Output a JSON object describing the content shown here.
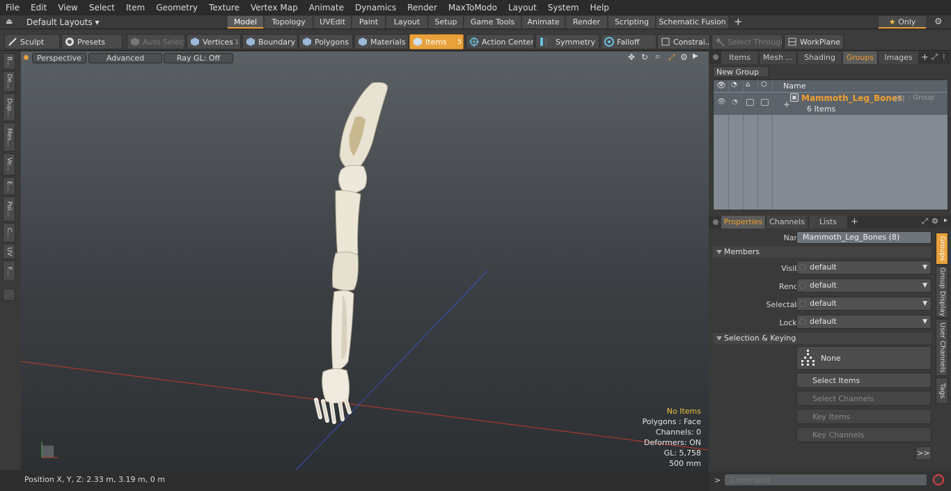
{
  "menu": [
    "File",
    "Edit",
    "View",
    "Select",
    "Item",
    "Geometry",
    "Texture",
    "Vertex Map",
    "Animate",
    "Dynamics",
    "Render",
    "MaxToModo",
    "Layout",
    "System",
    "Help"
  ],
  "layouts": {
    "label": "Default Layouts"
  },
  "mode_tabs": [
    "Model",
    "Topology",
    "UVEdit",
    "Paint",
    "Layout",
    "Setup",
    "Game Tools",
    "Animate",
    "Render",
    "Scripting",
    "Schematic Fusion"
  ],
  "only_label": "Only",
  "toolbar": {
    "sculpt": "Sculpt",
    "presets": "Presets",
    "auto_select": "Auto Select",
    "vertices": "Vertices",
    "vertices_count": "1",
    "boundary": "Boundary",
    "polygons": "Polygons",
    "materials": "Materials",
    "items": "Items",
    "items_count": "5",
    "action_center": "Action Center",
    "symmetry": "Symmetry",
    "falloff": "Falloff",
    "constraints": "Constrai...",
    "select_through": "Select Through",
    "workplane": "WorkPlane"
  },
  "left_tabs": [
    "B...",
    "De...",
    "Dup...",
    "Mes...",
    "Ve...",
    "E...",
    "Pol...",
    "C...",
    "UV",
    "F..."
  ],
  "viewport": {
    "perspective": "Perspective",
    "advanced": "Advanced",
    "raygl": "Ray GL: Off",
    "hud": {
      "no_items": "No Items",
      "polygons": "Polygons : Face",
      "channels": "Channels: 0",
      "deformers": "Deformers: ON",
      "gl": "GL: 5,758",
      "scale": "500 mm"
    }
  },
  "status": {
    "position": "Position X, Y, Z:   2.33 m, 3.19 m, 0 m"
  },
  "right_tabs": [
    "Items",
    "Mesh ...",
    "Shading",
    "Groups",
    "Images"
  ],
  "groups": {
    "new_group": "New Group",
    "name_header": "Name",
    "row": {
      "name": "Mammoth_Leg_Bones",
      "count": "(8)",
      "type": ": Group",
      "items": "6 Items"
    }
  },
  "prop_tabs": [
    "Properties",
    "Channels",
    "Lists"
  ],
  "props": {
    "name_label": "Name",
    "name_value": "Mammoth_Leg_Bones (8)",
    "members": "Members",
    "rows": [
      {
        "label": "Visible",
        "value": "default"
      },
      {
        "label": "Render",
        "value": "default"
      },
      {
        "label": "Selectable",
        "value": "default"
      },
      {
        "label": "Locked",
        "value": "default"
      }
    ],
    "sel_keying": "Selection & Keying",
    "none": "None",
    "select_items": "Select Items",
    "select_channels": "Select Channels",
    "key_items": "Key Items",
    "key_channels": "Key Channels",
    "more": ">>"
  },
  "side_tabs": [
    "Groups",
    "Group Display",
    "User Channels",
    "Tags"
  ],
  "command": {
    "placeholder": "Command",
    "prompt": ">"
  }
}
